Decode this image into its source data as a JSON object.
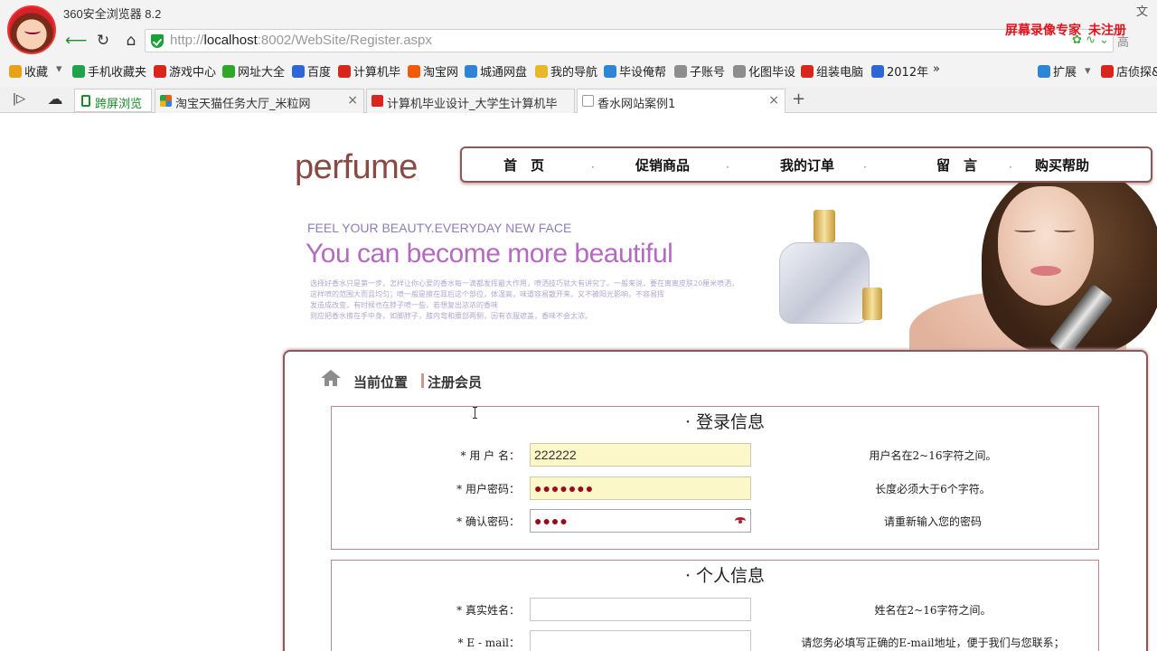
{
  "browser": {
    "app_title": "360安全浏览器 8.2",
    "top_right_mark": "文",
    "recorder_mark": "屏幕录像专家",
    "recorder_sub": "未注册",
    "url_scheme": "http://",
    "url_host": "localhost",
    "url_rest": ":8002/WebSite/Register.aspx",
    "url_right": "高",
    "bookmarks": [
      {
        "label": "收藏",
        "icon": "star-icon",
        "color": "#e8a21a"
      },
      {
        "label": "手机收藏夹",
        "icon": "phone-icon",
        "color": "#1ea34a"
      },
      {
        "label": "游戏中心",
        "icon": "game-icon",
        "color": "#d8261f"
      },
      {
        "label": "网址大全",
        "icon": "globe-icon",
        "color": "#2fa52a"
      },
      {
        "label": "百度",
        "icon": "baidu-paw-icon",
        "color": "#2e66d6"
      },
      {
        "label": "计算机毕",
        "icon": "bi-icon",
        "color": "#d8261f"
      },
      {
        "label": "淘宝网",
        "icon": "taobao-icon",
        "color": "#f25a0a"
      },
      {
        "label": "城通网盘",
        "icon": "ct-icon",
        "color": "#2e85d6"
      },
      {
        "label": "我的导航",
        "icon": "folder-icon",
        "color": "#e8b82a"
      },
      {
        "label": "毕设俺帮",
        "icon": "help-icon",
        "color": "#2e85d6"
      },
      {
        "label": "子账号",
        "icon": "page-icon",
        "color": "#8d8d8d"
      },
      {
        "label": "化图毕设",
        "icon": "page-icon",
        "color": "#8d8d8d"
      },
      {
        "label": "组装电脑",
        "icon": "taobao-icon",
        "color": "#d8261f"
      },
      {
        "label": "2012年",
        "icon": "baidu-paw-icon",
        "color": "#2e66d6"
      }
    ],
    "bookmark_more": "»",
    "extensions_label": "扩展",
    "shop_label": "店侦探&",
    "split_tab_label": "跨屏浏览",
    "tabs": [
      {
        "label": "淘宝天猫任务大厅_米粒网",
        "active": false
      },
      {
        "label": "计算机毕业设计_大学生计算机毕",
        "active": false
      },
      {
        "label": "香水网站案例1",
        "active": true
      }
    ]
  },
  "site": {
    "logo": "perfume",
    "menu": [
      "首　页",
      "促销商品",
      "我的订单",
      "留　言",
      "购买帮助"
    ],
    "banner_sub": "FEEL YOUR BEAUTY.EVERYDAY NEW FACE",
    "banner_title": "You can become more beautiful",
    "banner_lines": [
      "选择好香水只是第一步，怎样让你心爱的香水每一滴都发挥最大作用，喷洒技巧就大有讲究了。一般来说，要在离离皮肤20厘米喷洒，",
      "这样喷的范围大而且均匀；喷一般是擦在耳后这个部位，体温高，味道容易散开来，又不被阳光影响，不容易挥",
      "发造成改变，有时候也在脖子喷一些，若想复出浓浓的香味",
      "则应把香水擦在手中身，如脚脖子，膝内弯和腰部两侧，因有衣服遮盖，香味不会太浓。"
    ],
    "breadcrumb_label": "当前位置",
    "breadcrumb_page": "注册会员",
    "login_section": {
      "title": "· 登录信息",
      "rows": [
        {
          "label": "* 用 户 名：",
          "value": "222222",
          "hint": "用户名在2~16字符之间。"
        },
        {
          "label": "* 用户密码：",
          "value": "●●●●●●●",
          "hint": "长度必须大于6个字符。"
        },
        {
          "label": "* 确认密码：",
          "value": "●●●●",
          "hint": "请重新输入您的密码"
        }
      ]
    },
    "personal_section": {
      "title": "· 个人信息",
      "rows": [
        {
          "label": "* 真实姓名：",
          "value": "",
          "hint": "姓名在2~16字符之间。"
        },
        {
          "label": "* E - mail：",
          "value": "",
          "hint": "请您务必填写正确的E-mail地址，便于我们与您联系；"
        }
      ]
    }
  }
}
